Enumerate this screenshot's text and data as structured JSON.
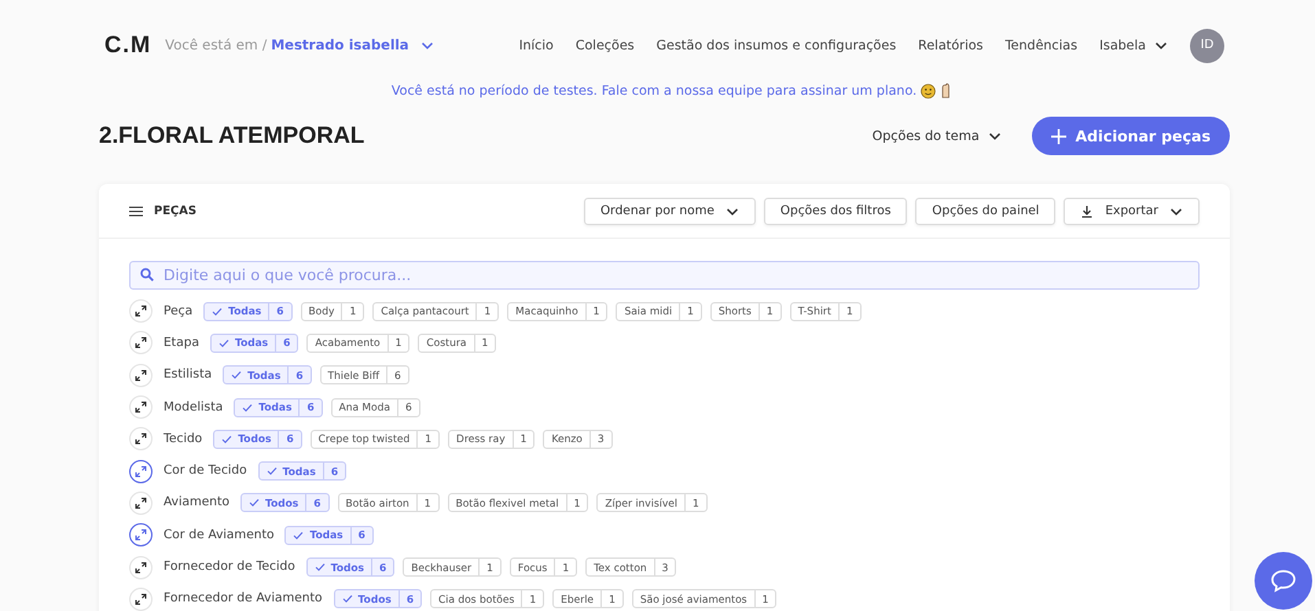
{
  "header": {
    "logo": "C.M",
    "breadcrumb_prefix": "Você está em /",
    "workspace": "Mestrado isabella",
    "nav": [
      "Início",
      "Coleções",
      "Gestão dos insumos e configurações",
      "Relatórios",
      "Tendências"
    ],
    "user": "Isabela",
    "avatar": "ID"
  },
  "banner": "Você está no período de testes. Fale com a nossa equipe para assinar um plano.",
  "page_title": "2.FLORAL ATEMPORAL",
  "theme_options": "Opções do tema",
  "add_button": "Adicionar peças",
  "panel": {
    "title": "PEÇAS",
    "buttons": [
      {
        "label": "Ordenar por nome",
        "kind": "dropdown"
      },
      {
        "label": "Opções dos filtros",
        "kind": "plain"
      },
      {
        "label": "Opções do painel",
        "kind": "plain"
      },
      {
        "label": "Exportar",
        "kind": "export"
      }
    ],
    "search": {
      "placeholder": "Digite aqui o que você procura..."
    },
    "filters": [
      {
        "label": "Peça",
        "active": false,
        "chips": [
          {
            "label": "Todas",
            "count": "6",
            "selected": true
          },
          {
            "label": "Body",
            "count": "1",
            "selected": false
          },
          {
            "label": "Calça pantacourt",
            "count": "1",
            "selected": false
          },
          {
            "label": "Macaquinho",
            "count": "1",
            "selected": false
          },
          {
            "label": "Saia midi",
            "count": "1",
            "selected": false
          },
          {
            "label": "Shorts",
            "count": "1",
            "selected": false
          },
          {
            "label": "T-Shirt",
            "count": "1",
            "selected": false
          }
        ]
      },
      {
        "label": "Etapa",
        "active": false,
        "chips": [
          {
            "label": "Todas",
            "count": "6",
            "selected": true
          },
          {
            "label": "Acabamento",
            "count": "1",
            "selected": false
          },
          {
            "label": "Costura",
            "count": "1",
            "selected": false
          }
        ]
      },
      {
        "label": "Estilista",
        "active": false,
        "chips": [
          {
            "label": "Todas",
            "count": "6",
            "selected": true
          },
          {
            "label": "Thiele Biff",
            "count": "6",
            "selected": false
          }
        ]
      },
      {
        "label": "Modelista",
        "active": false,
        "chips": [
          {
            "label": "Todas",
            "count": "6",
            "selected": true
          },
          {
            "label": "Ana Moda",
            "count": "6",
            "selected": false
          }
        ]
      },
      {
        "label": "Tecido",
        "active": false,
        "chips": [
          {
            "label": "Todos",
            "count": "6",
            "selected": true
          },
          {
            "label": "Crepe top twisted",
            "count": "1",
            "selected": false
          },
          {
            "label": "Dress ray",
            "count": "1",
            "selected": false
          },
          {
            "label": "Kenzo",
            "count": "3",
            "selected": false
          }
        ]
      },
      {
        "label": "Cor de Tecido",
        "active": true,
        "chips": [
          {
            "label": "Todas",
            "count": "6",
            "selected": true
          }
        ]
      },
      {
        "label": "Aviamento",
        "active": false,
        "chips": [
          {
            "label": "Todos",
            "count": "6",
            "selected": true
          },
          {
            "label": "Botão airton",
            "count": "1",
            "selected": false
          },
          {
            "label": "Botão flexivel metal",
            "count": "1",
            "selected": false
          },
          {
            "label": "Zíper invisível",
            "count": "1",
            "selected": false
          }
        ]
      },
      {
        "label": "Cor de Aviamento",
        "active": true,
        "chips": [
          {
            "label": "Todas",
            "count": "6",
            "selected": true
          }
        ]
      },
      {
        "label": "Fornecedor de Tecido",
        "active": false,
        "chips": [
          {
            "label": "Todos",
            "count": "6",
            "selected": true
          },
          {
            "label": "Beckhauser",
            "count": "1",
            "selected": false
          },
          {
            "label": "Focus",
            "count": "1",
            "selected": false
          },
          {
            "label": "Tex cotton",
            "count": "3",
            "selected": false
          }
        ]
      },
      {
        "label": "Fornecedor de Aviamento",
        "active": false,
        "chips": [
          {
            "label": "Todos",
            "count": "6",
            "selected": true
          },
          {
            "label": "Cia dos botões",
            "count": "1",
            "selected": false
          },
          {
            "label": "Eberle",
            "count": "1",
            "selected": false
          },
          {
            "label": "São josé aviamentos",
            "count": "1",
            "selected": false
          }
        ]
      }
    ]
  }
}
